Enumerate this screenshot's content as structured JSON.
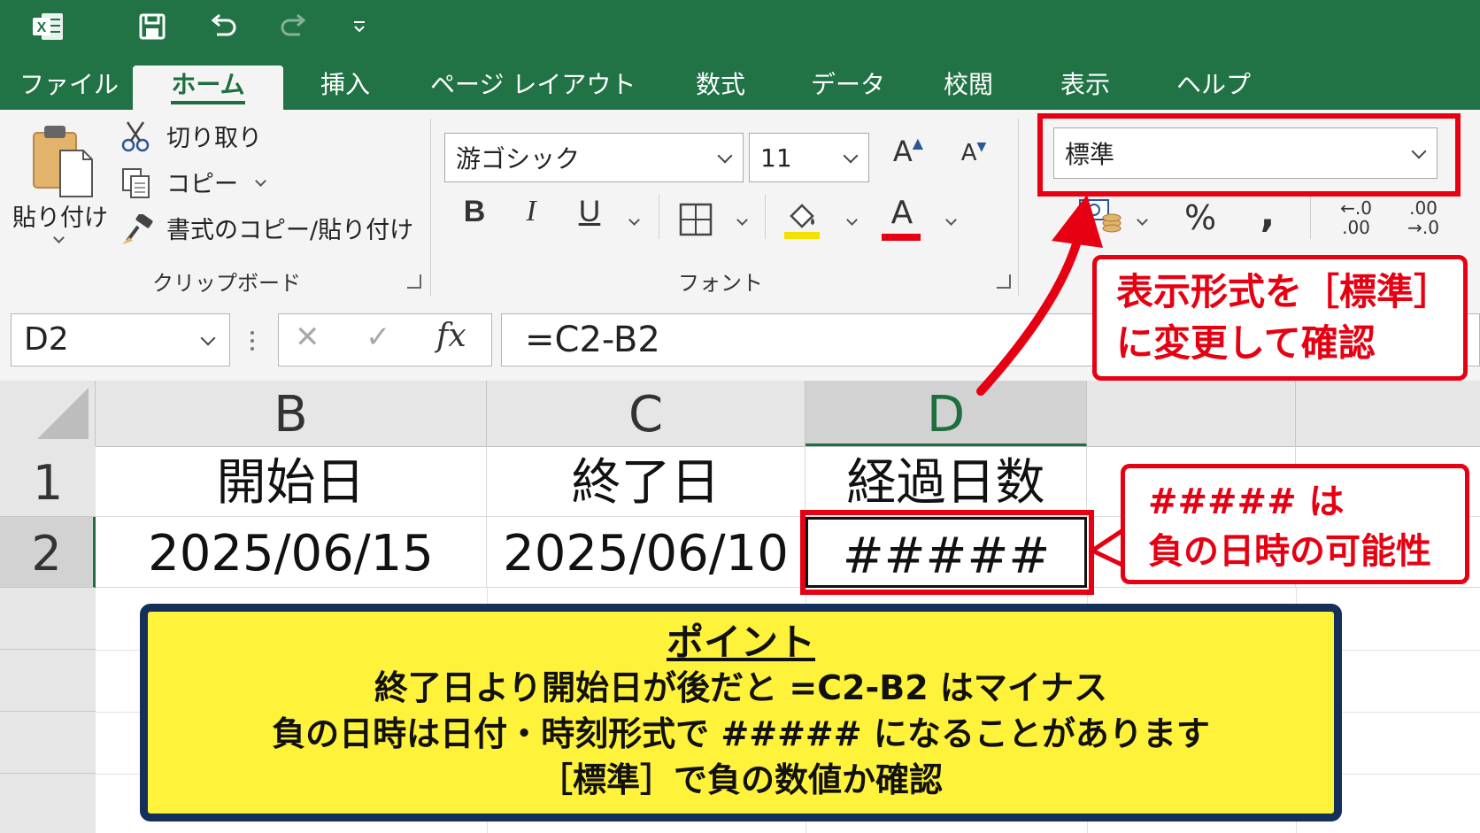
{
  "app": {
    "logo_letter": "X"
  },
  "tabs": [
    {
      "label": "ファイル"
    },
    {
      "label": "ホーム"
    },
    {
      "label": "挿入"
    },
    {
      "label": "ページ レイアウト"
    },
    {
      "label": "数式"
    },
    {
      "label": "データ"
    },
    {
      "label": "校閲"
    },
    {
      "label": "表示"
    },
    {
      "label": "ヘルプ"
    }
  ],
  "clipboard": {
    "paste": "貼り付け",
    "cut": "切り取り",
    "copy": "コピー",
    "format_painter": "書式のコピー/貼り付け",
    "group_label": "クリップボード"
  },
  "font": {
    "name": "游ゴシック",
    "size": "11",
    "bold": "B",
    "italic": "I",
    "underline": "U",
    "grow": "A",
    "shrink": "A",
    "color_letter": "A",
    "group_label": "フォント",
    "fill_color": "#f5e100",
    "font_color": "#e60012"
  },
  "number": {
    "format": "標準",
    "percent": "%",
    "comma": ",",
    "inc_decimal_top": "←.0",
    "inc_decimal_bottom": ".00",
    "dec_decimal_top": ".00",
    "dec_decimal_bottom": "→.0"
  },
  "formula_bar": {
    "name_box": "D2",
    "cancel": "✕",
    "enter": "✓",
    "fx": "fx",
    "formula": "=C2-B2"
  },
  "grid": {
    "columns": [
      "B",
      "C",
      "D"
    ],
    "rows": [
      "1",
      "2"
    ],
    "cells": {
      "B1": "開始日",
      "C1": "終了日",
      "D1": "経過日数",
      "B2": "2025/06/15",
      "C2": "2025/06/10",
      "D2": "#####"
    }
  },
  "callouts": {
    "format_line1": "表示形式を［標準］",
    "format_line2": "に変更して確認",
    "hash_line1": "##### は",
    "hash_line2": "負の日時の可能性"
  },
  "point": {
    "title": "ポイント",
    "line1": "終了日より開始日が後だと =C2-B2 はマイナス",
    "line2": "負の日時は日付・時刻形式で ##### になることがあります",
    "line3": "［標準］で負の数値か確認"
  },
  "colors": {
    "excel_green": "#217346",
    "highlight_red": "#e60012",
    "note_yellow": "#fff23a",
    "note_border": "#14305a"
  }
}
